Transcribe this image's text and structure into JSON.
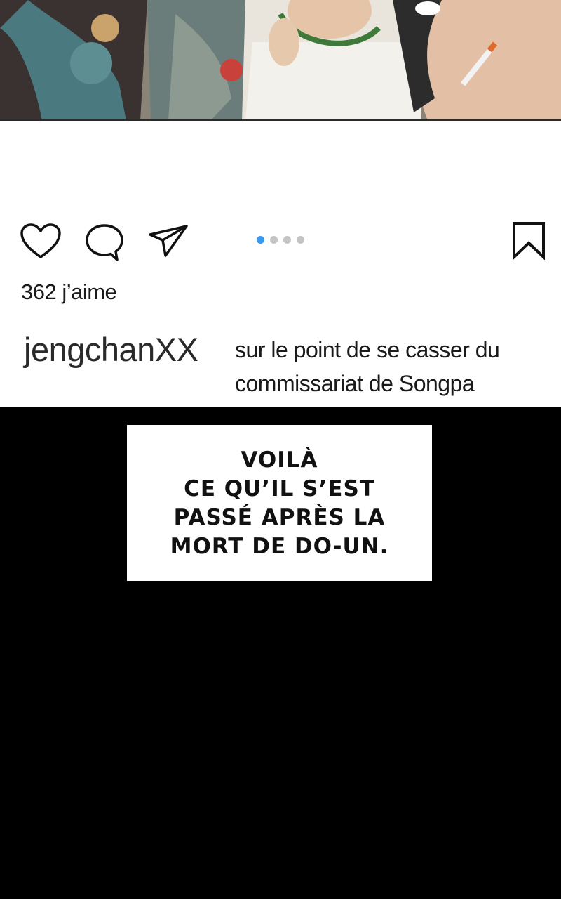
{
  "post": {
    "likes_text": "362 j’aime",
    "username": "jengchanXX",
    "caption_lines": [
      "sur le point de se casser du",
      "commissariat de Songpa"
    ],
    "carousel": {
      "count": 4,
      "active_index": 0
    },
    "icons": {
      "like": "heart-icon",
      "comment": "comment-bubble-icon",
      "share": "paper-plane-icon",
      "save": "bookmark-icon"
    }
  },
  "narration": {
    "lines": [
      "VOILÀ",
      "CE QU’IL S’EST",
      "PASSÉ APRÈS LA",
      "MORT DE DO-UN."
    ]
  },
  "colors": {
    "carousel_active": "#3897f0",
    "carousel_inactive": "#c4c4c4",
    "panel_background": "#000000"
  }
}
